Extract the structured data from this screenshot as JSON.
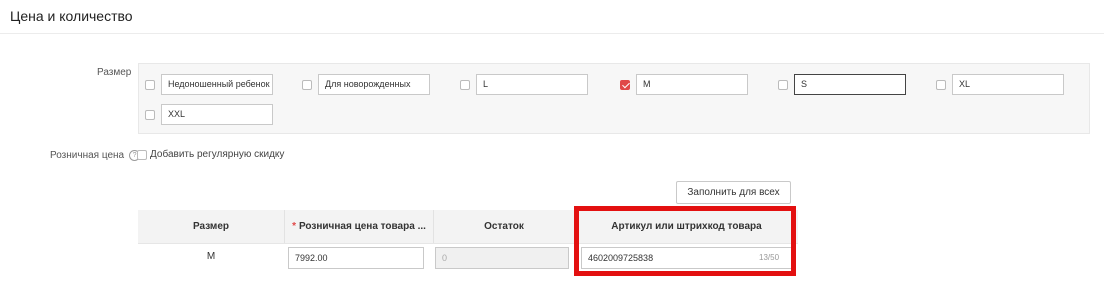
{
  "section": {
    "title": "Цена и количество"
  },
  "sizes": {
    "label": "Размер",
    "options": [
      {
        "value": "Недоношенный ребенок",
        "checked": false
      },
      {
        "value": "Для новорожденных",
        "checked": false
      },
      {
        "value": "L",
        "checked": false
      },
      {
        "value": "M",
        "checked": true
      },
      {
        "value": "S",
        "checked": false
      },
      {
        "value": "XL",
        "checked": false
      },
      {
        "value": "XXL",
        "checked": false
      }
    ]
  },
  "price": {
    "label": "Розничная цена",
    "help_icon": "?",
    "discount_label": "Добавить регулярную скидку"
  },
  "fill_button": "Заполнить для всех",
  "table": {
    "headers": {
      "size": "Размер",
      "required_mark": "*",
      "price": "Розничная цена товара ...",
      "stock": "Остаток",
      "article": "Артикул или штрихкод товара"
    },
    "rows": [
      {
        "size": "M",
        "price": "7992.00",
        "stock_placeholder": "0",
        "article": "4602009725838",
        "article_counter": "13/50"
      }
    ]
  },
  "colors": {
    "accent": "#e04848",
    "highlight": "#e31010"
  }
}
